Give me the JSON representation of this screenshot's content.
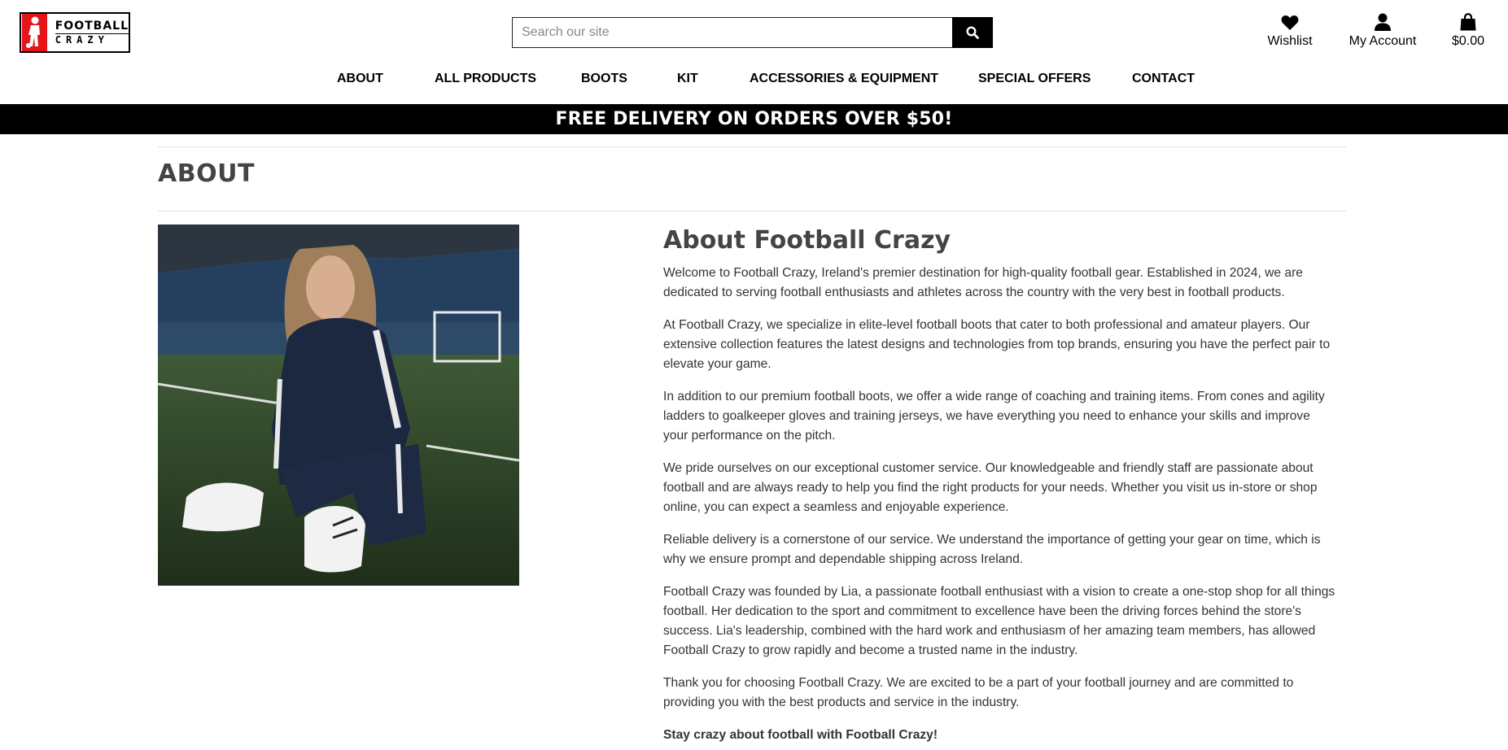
{
  "brand": {
    "line1": "FOOTBALL",
    "line2": "CRAZY",
    "accent": "#e3151a"
  },
  "search": {
    "placeholder": "Search our site",
    "icon": "search-icon"
  },
  "utility": {
    "wishlist": {
      "label": "Wishlist",
      "icon": "heart-icon"
    },
    "account": {
      "label": "My Account",
      "icon": "user-icon"
    },
    "cart": {
      "label": "$0.00",
      "icon": "shopping-bag-icon"
    }
  },
  "nav": [
    "ABOUT",
    "ALL PRODUCTS",
    "BOOTS",
    "KIT",
    "ACCESSORIES & EQUIPMENT",
    "SPECIAL OFFERS",
    "CONTACT"
  ],
  "banner": {
    "text": "FREE DELIVERY ON ORDERS OVER $50!"
  },
  "page": {
    "title": "ABOUT"
  },
  "about": {
    "heading": "About Football Crazy",
    "paragraphs": [
      "Welcome to Football Crazy, Ireland's premier destination for high-quality football gear. Established in 2024, we are dedicated to serving football enthusiasts and athletes across the country with the very best in football products.",
      "At Football Crazy, we specialize in elite-level football boots that cater to both professional and amateur players. Our extensive collection features the latest designs and technologies from top brands, ensuring you have the perfect pair to elevate your game.",
      "In addition to our premium football boots, we offer a wide range of coaching and training items. From cones and agility ladders to goalkeeper gloves and training jerseys, we have everything you need to enhance your skills and improve your performance on the pitch.",
      "We pride ourselves on our exceptional customer service. Our knowledgeable and friendly staff are passionate about football and are always ready to help you find the right products for your needs. Whether you visit us in-store or shop online, you can expect a seamless and enjoyable experience.",
      "Reliable delivery is a cornerstone of our service. We understand the importance of getting your gear on time, which is why we ensure prompt and dependable shipping across Ireland.",
      "Football Crazy was founded by Lia, a passionate football enthusiast with a vision to create a one-stop shop for all things football. Her dedication to the sport and commitment to excellence have been the driving forces behind the store's success. Lia's leadership, combined with the hard work and enthusiasm of her amazing team members, has allowed Football Crazy to grow rapidly and become a trusted name in the industry.",
      "Thank you for choosing Football Crazy. We are excited to be a part of your football journey and are committed to providing you with the best products and service in the industry."
    ],
    "tagline": "Stay crazy about football with Football Crazy!"
  }
}
